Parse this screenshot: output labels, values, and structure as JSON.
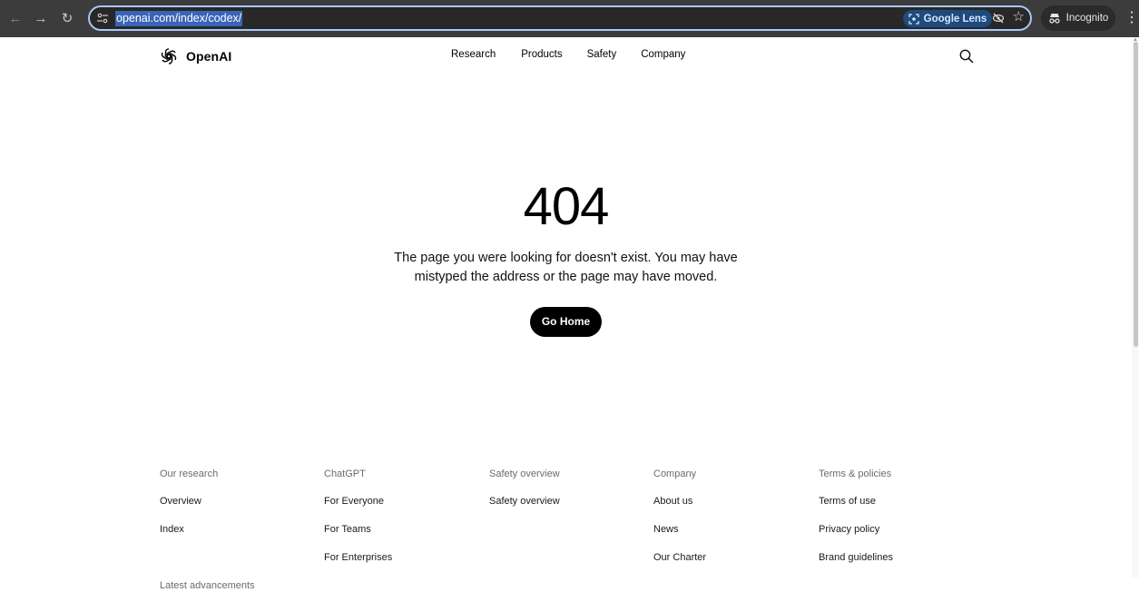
{
  "browser": {
    "url": "openai.com/index/codex/",
    "lens_label": "Google Lens",
    "profile_label": "Incognito"
  },
  "header": {
    "brand": "OpenAI",
    "nav": [
      "Research",
      "Products",
      "Safety",
      "Company"
    ]
  },
  "error": {
    "code": "404",
    "message": "The page you were looking for doesn't exist. You may have mistyped the address or the page may have moved.",
    "button_label": "Go Home"
  },
  "footer": {
    "columns": [
      {
        "heading": "Our research",
        "items": [
          "Overview",
          "Index"
        ],
        "trailing": "Latest advancements"
      },
      {
        "heading": "ChatGPT",
        "items": [
          "For Everyone",
          "For Teams",
          "For Enterprises"
        ]
      },
      {
        "heading": "Safety overview",
        "items": [
          "Safety overview"
        ]
      },
      {
        "heading": "Company",
        "items": [
          "About us",
          "News",
          "Our Charter"
        ]
      },
      {
        "heading": "Terms & policies",
        "items": [
          "Terms of use",
          "Privacy policy",
          "Brand guidelines"
        ]
      }
    ]
  }
}
